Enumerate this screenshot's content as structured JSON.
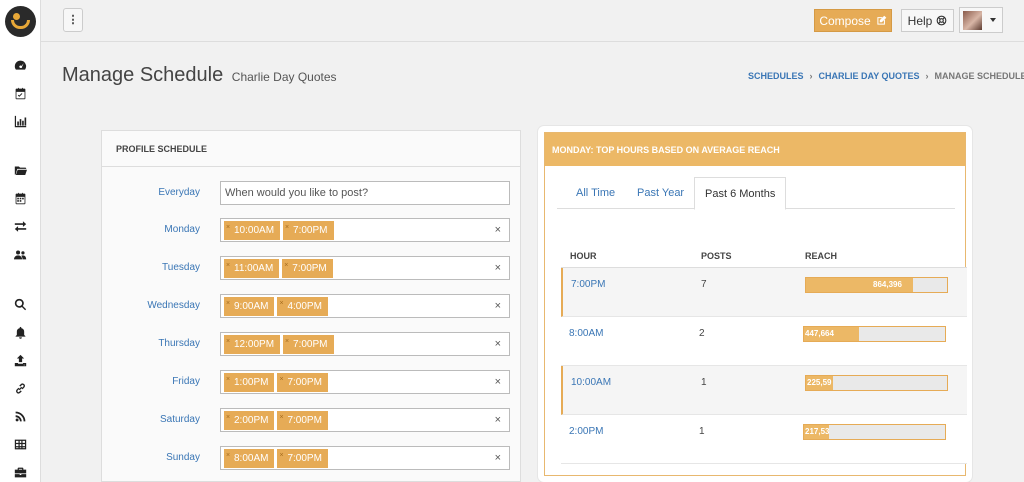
{
  "topbar": {
    "compose_label": "Compose",
    "help_label": "Help"
  },
  "header": {
    "title": "Manage Schedule",
    "subtitle": "Charlie Day Quotes",
    "breadcrumb": [
      "SCHEDULES",
      "CHARLIE DAY QUOTES",
      "MANAGE SCHEDULE"
    ]
  },
  "sidebar": {
    "icons": [
      "dashboard-icon",
      "calendar-check-icon",
      "bar-chart-icon",
      "folder-icon",
      "calendar-icon",
      "exchange-icon",
      "users-icon",
      "search-icon",
      "bell-icon",
      "upload-icon",
      "link-icon",
      "rss-icon",
      "table-icon",
      "briefcase-icon"
    ]
  },
  "schedule": {
    "title": "PROFILE SCHEDULE",
    "everyday_label": "Everyday",
    "everyday_placeholder": "When would you like to post?",
    "days": [
      {
        "label": "Monday",
        "times": [
          "10:00AM",
          "7:00PM"
        ]
      },
      {
        "label": "Tuesday",
        "times": [
          "11:00AM",
          "7:00PM"
        ]
      },
      {
        "label": "Wednesday",
        "times": [
          "9:00AM",
          "4:00PM"
        ]
      },
      {
        "label": "Thursday",
        "times": [
          "12:00PM",
          "7:00PM"
        ]
      },
      {
        "label": "Friday",
        "times": [
          "1:00PM",
          "7:00PM"
        ]
      },
      {
        "label": "Saturday",
        "times": [
          "2:00PM",
          "7:00PM"
        ]
      },
      {
        "label": "Sunday",
        "times": [
          "8:00AM",
          "7:00PM"
        ]
      }
    ]
  },
  "reach": {
    "title": "MONDAY: TOP HOURS BASED ON AVERAGE REACH",
    "tabs": [
      "All Time",
      "Past Year",
      "Past 6 Months"
    ],
    "active_tab": 2,
    "columns": [
      "HOUR",
      "POSTS",
      "REACH"
    ],
    "rows": [
      {
        "hour": "7:00PM",
        "posts": "7",
        "reach": "864,396",
        "fraction": 0.76
      },
      {
        "hour": "8:00AM",
        "posts": "2",
        "reach": "447,664",
        "fraction": 0.39
      },
      {
        "hour": "10:00AM",
        "posts": "1",
        "reach": "225,59",
        "fraction": 0.19
      },
      {
        "hour": "2:00PM",
        "posts": "1",
        "reach": "217,53",
        "fraction": 0.18
      }
    ]
  }
}
